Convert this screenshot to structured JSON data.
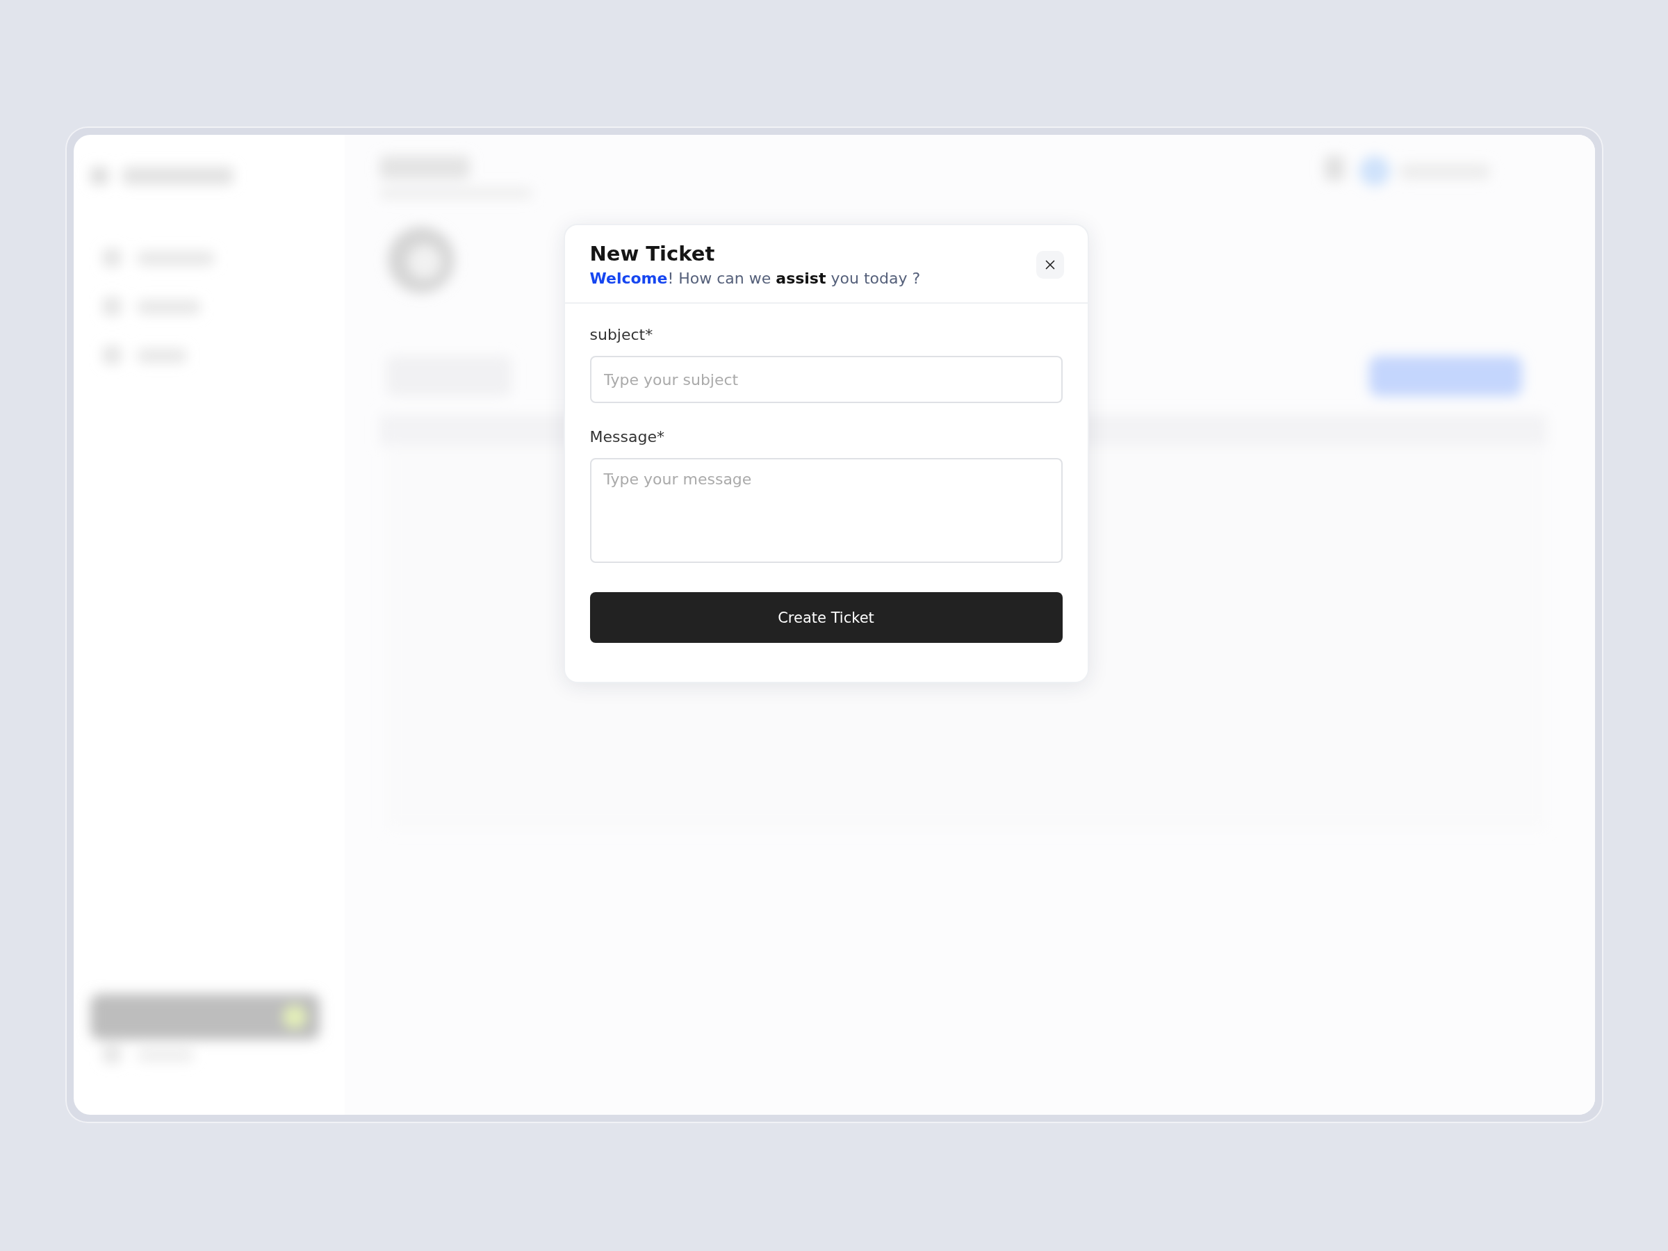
{
  "dialog": {
    "title": "New Ticket",
    "subtitle": "**Welcome**! How can we **assist** you today ?",
    "fields": [
      {
        "kind": "input",
        "label": "subject*",
        "placeholder": "Type your subject"
      },
      {
        "kind": "textarea",
        "label": "Message*",
        "placeholder": "Type your message"
      }
    ],
    "submit": "Create Ticket"
  }
}
